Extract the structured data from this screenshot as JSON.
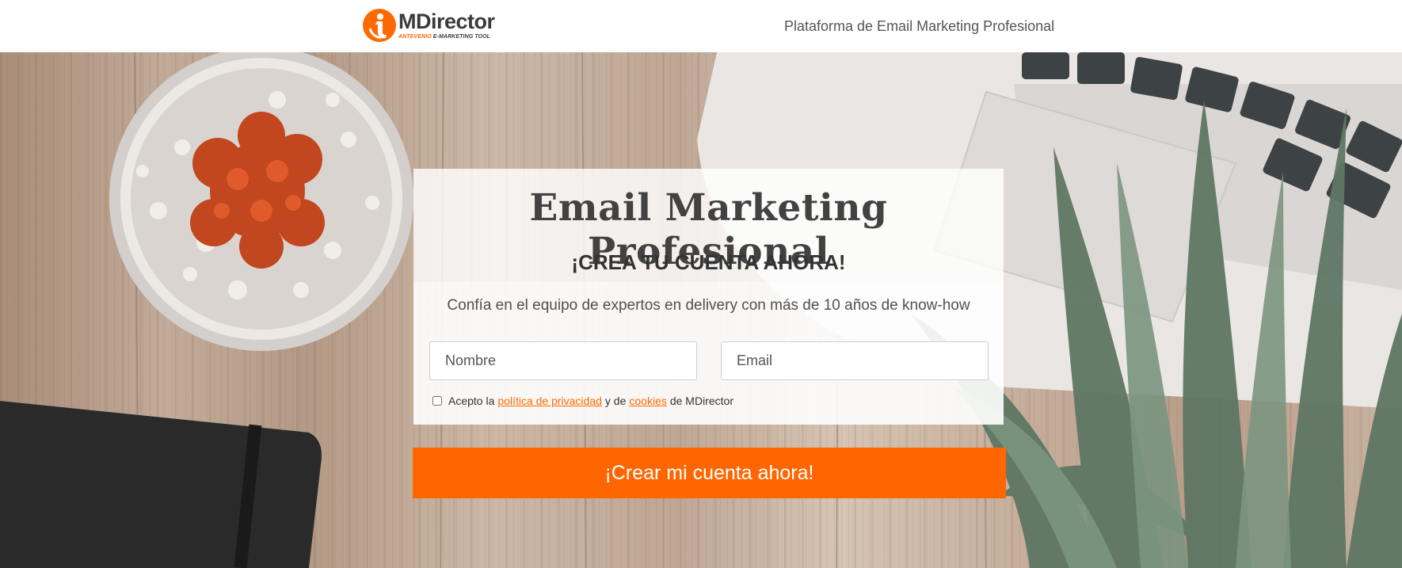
{
  "header": {
    "logo_name": "MDirector",
    "logo_tag_brand": "ANTEVENIO",
    "logo_tag_rest": "E-MARKETING TOOL",
    "tagline": "Plataforma de Email Marketing Profesional"
  },
  "hero": {
    "title": "Email Marketing Profesional",
    "subtitle": "¡CREA TU CUENTA AHORA!",
    "lead": "Confía en el equipo de expertos en delivery con más de 10 años de know-how"
  },
  "form": {
    "name_placeholder": "Nombre",
    "name_value": "",
    "email_placeholder": "Email",
    "email_value": "",
    "consent_checked": false,
    "consent_prefix": "Acepto la",
    "privacy_link": "política de privacidad",
    "consent_middle": "y de",
    "cookies_link": "cookies",
    "consent_suffix": "de MDirector",
    "submit_label": "¡Crear mi cuenta ahora!"
  },
  "colors": {
    "accent": "#ff6600",
    "link": "#ff6a00",
    "text_dark": "#424242"
  },
  "icons": [
    "mdirector-logo-icon",
    "checkbox"
  ]
}
